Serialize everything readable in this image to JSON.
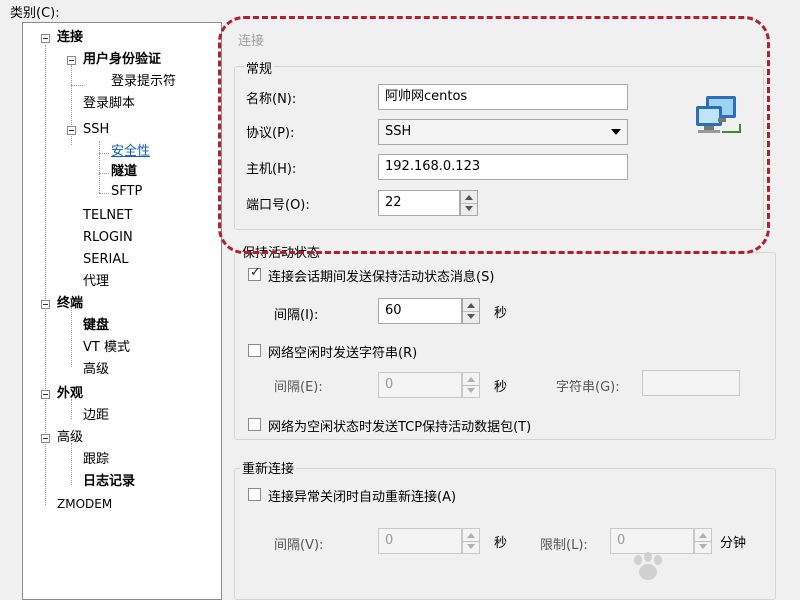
{
  "category_label": "类别(C):",
  "tree": {
    "connection": "连接",
    "auth": "用户身份验证",
    "login_prompt": "登录提示符",
    "login_script": "登录脚本",
    "ssh": "SSH",
    "security": "安全性",
    "tunnel": "隧道",
    "sftp": "SFTP",
    "telnet": "TELNET",
    "rlogin": "RLOGIN",
    "serial": "SERIAL",
    "proxy": "代理",
    "terminal": "终端",
    "keyboard": "键盘",
    "vt_mode": "VT 模式",
    "terminal_advanced": "高级",
    "appearance": "外观",
    "margin": "边距",
    "advanced": "高级",
    "trace": "跟踪",
    "log": "日志记录",
    "zmodem": "ZMODEM"
  },
  "panel": {
    "header": "连接",
    "general": {
      "legend": "常规",
      "name_label": "名称(N):",
      "name_value": "阿帅网centos",
      "protocol_label": "协议(P):",
      "protocol_value": "SSH",
      "host_label": "主机(H):",
      "host_value": "192.168.0.123",
      "port_label": "端口号(O):",
      "port_value": "22"
    },
    "keepalive": {
      "legend": "保持活动状态",
      "send_msg_label": "连接会话期间发送保持活动状态消息(S)",
      "send_msg_checked": true,
      "interval_label": "间隔(I):",
      "interval_value": "60",
      "unit_sec": "秒",
      "idle_string_label": "网络空闲时发送字符串(R)",
      "idle_string_checked": false,
      "idle_interval_label": "间隔(E):",
      "idle_interval_value": "0",
      "unit_sec2": "秒",
      "string_label": "字符串(G):",
      "string_value": "",
      "tcp_label": "网络为空闲状态时发送TCP保持活动数据包(T)",
      "tcp_checked": false
    },
    "reconnect": {
      "legend": "重新连接",
      "auto_label": "连接异常关闭时自动重新连接(A)",
      "auto_checked": false,
      "interval_label": "间隔(V):",
      "interval_value": "0",
      "unit_sec": "秒",
      "limit_label": "限制(L):",
      "limit_value": "0",
      "unit_min": "分钟"
    }
  },
  "icons": {
    "expand": "minus-box-icon",
    "connection": "network-computers-icon"
  },
  "colors": {
    "highlight": "#b02030",
    "selected_link": "#0b5fbf"
  }
}
